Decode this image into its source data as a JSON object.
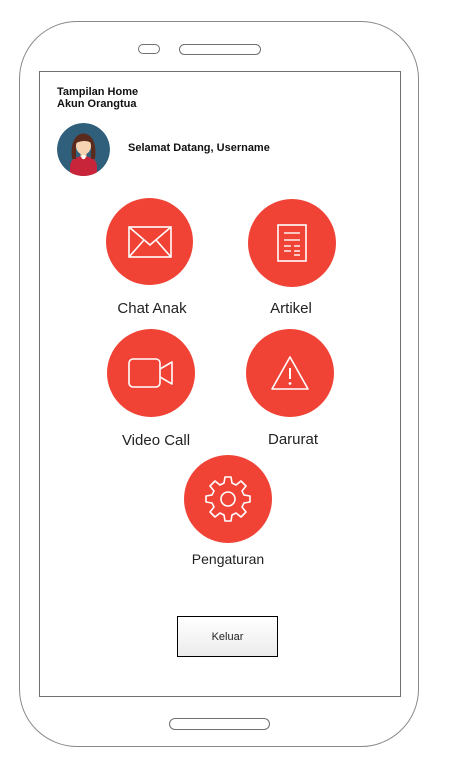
{
  "header": {
    "title_line1": "Tampilan Home",
    "title_line2": "Akun Orangtua"
  },
  "profile": {
    "greeting": "Selamat Datang, Username",
    "avatar_icon": "girl-avatar-icon"
  },
  "menu": {
    "chat_label": "Chat Anak",
    "artikel_label": "Artikel",
    "video_label": "Video Call",
    "darurat_label": "Darurat",
    "pengaturan_label": "Pengaturan"
  },
  "logout_label": "Keluar",
  "colors": {
    "accent": "#f04336",
    "avatar_bg": "#2f5f7a"
  }
}
